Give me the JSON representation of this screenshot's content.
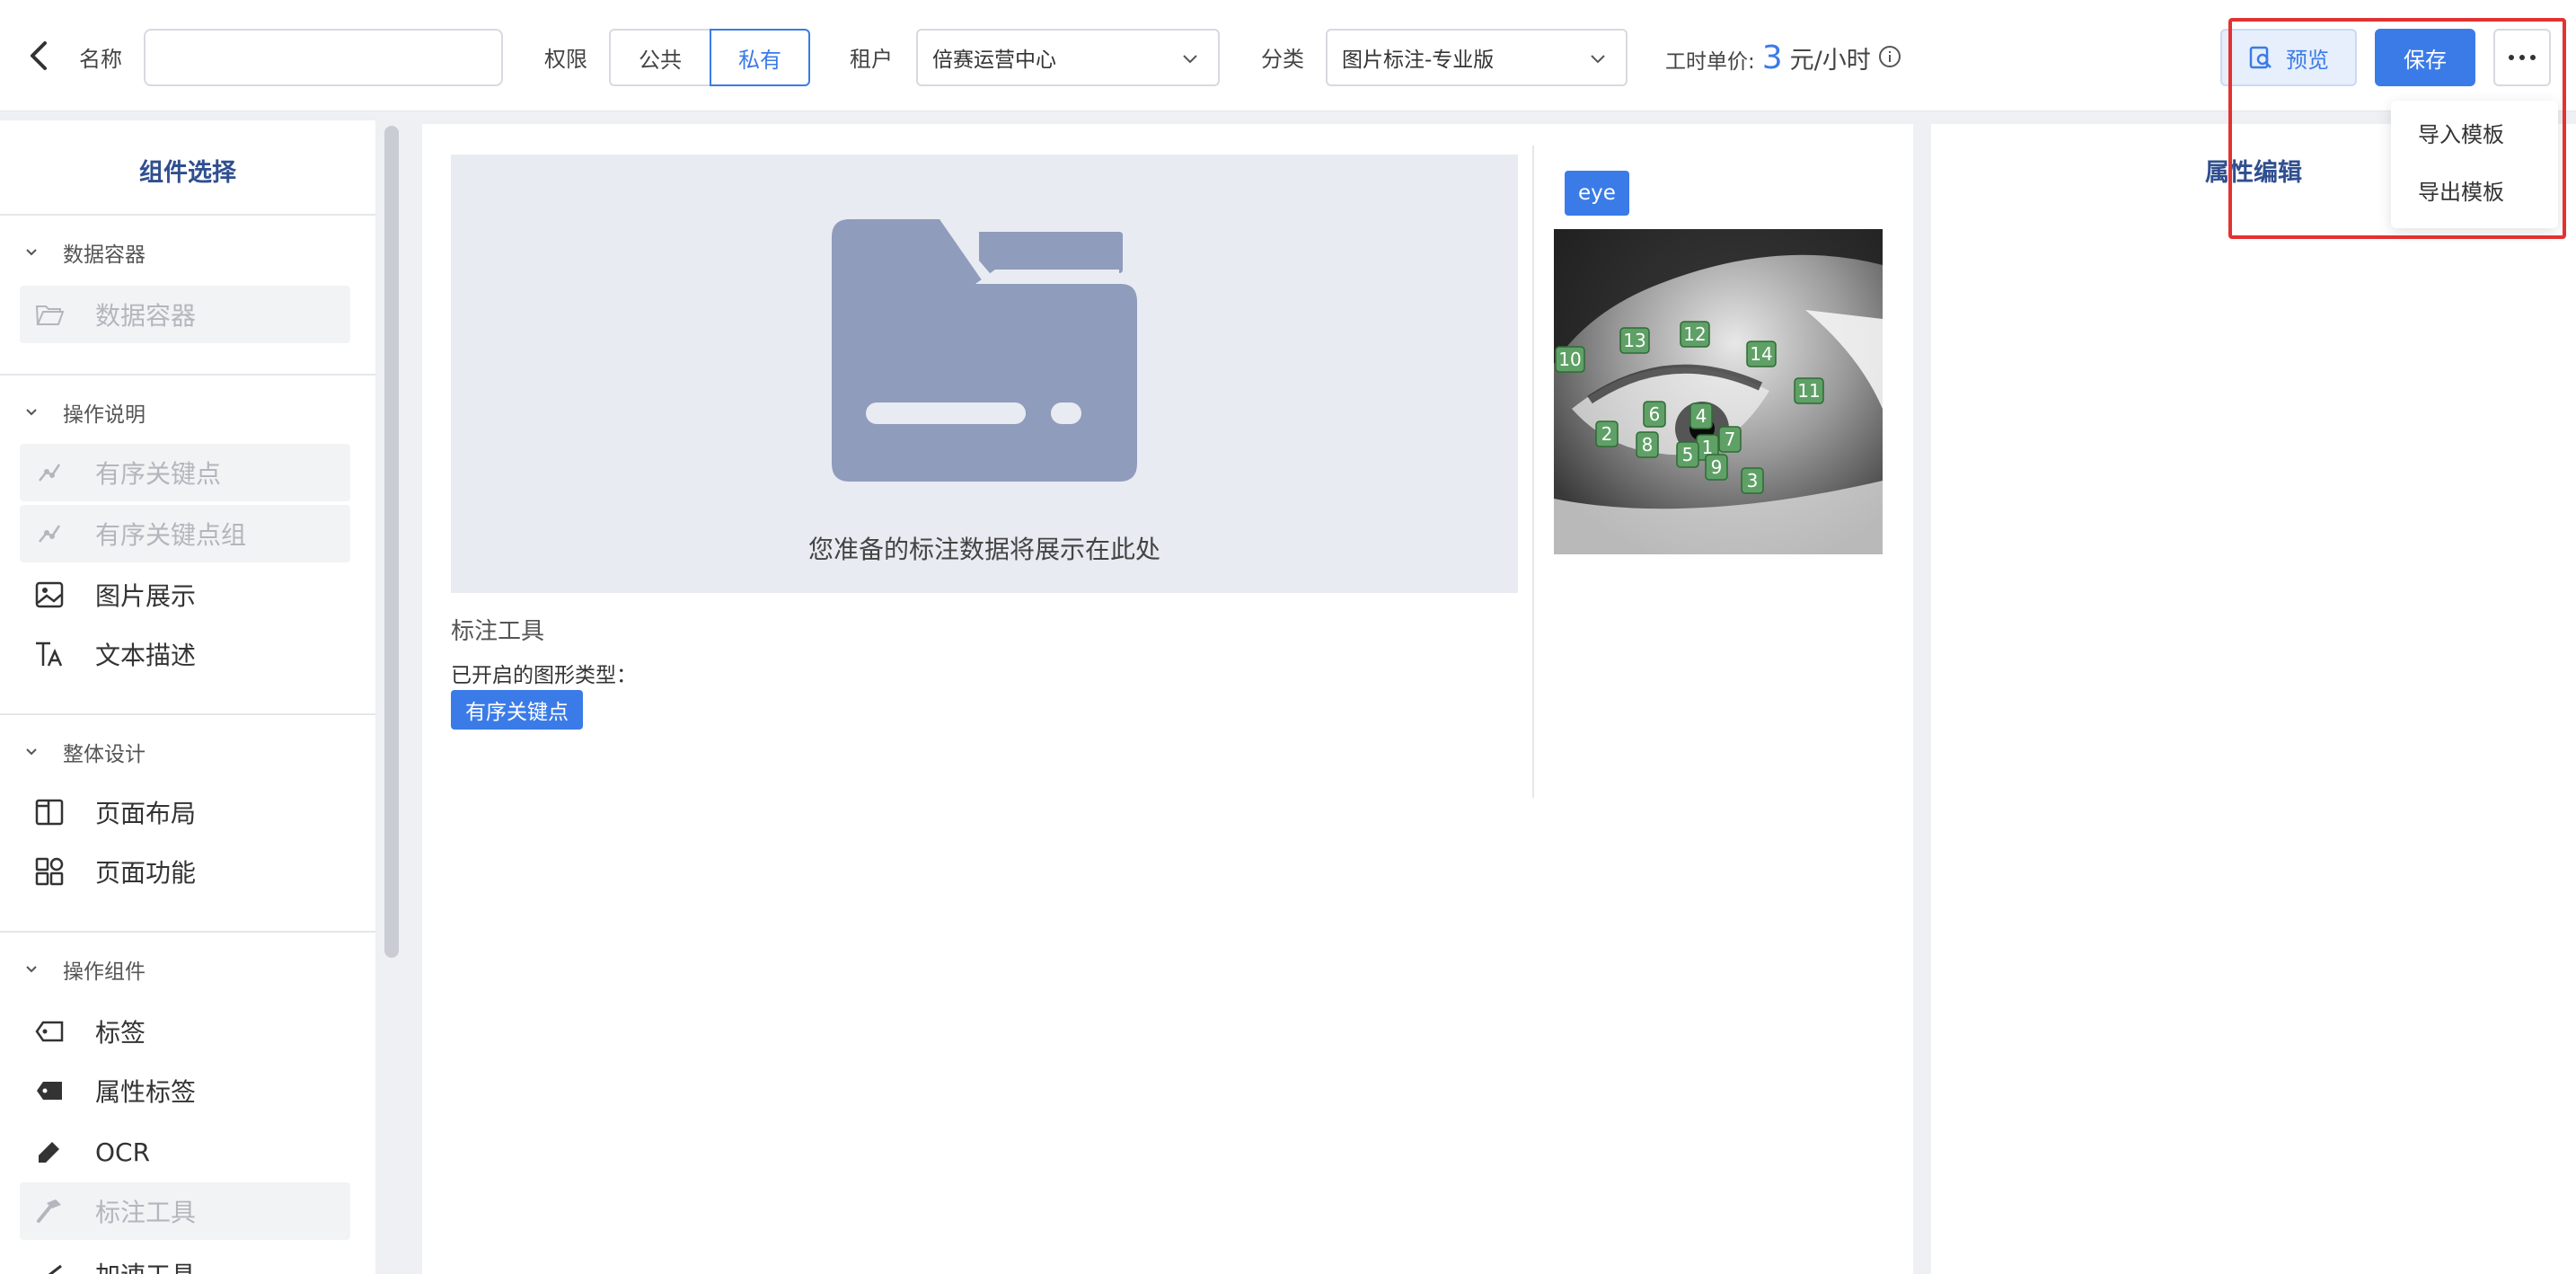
{
  "header": {
    "name_label": "名称",
    "name_value": "",
    "permission_label": "权限",
    "permission_options": [
      "公共",
      "私有"
    ],
    "tenant_label": "租户",
    "tenant_value": "倍赛运营中心",
    "category_label": "分类",
    "category_value": "图片标注-专业版",
    "price_label": "工时单价:",
    "price_value": "3",
    "price_unit": "元/小时",
    "preview_label": "预览",
    "save_label": "保存",
    "more_menu": [
      "导入模板",
      "导出模板"
    ]
  },
  "left_panel": {
    "title": "组件选择",
    "sections": [
      {
        "title": "数据容器",
        "items": [
          {
            "label": "数据容器",
            "icon": "folder-open-icon",
            "disabled": true
          }
        ]
      },
      {
        "title": "操作说明",
        "items": [
          {
            "label": "有序关键点",
            "icon": "keypoint-icon",
            "disabled": true
          },
          {
            "label": "有序关键点组",
            "icon": "keypoint-group-icon",
            "disabled": true
          },
          {
            "label": "图片展示",
            "icon": "image-icon",
            "disabled": false
          },
          {
            "label": "文本描述",
            "icon": "text-icon",
            "disabled": false
          }
        ]
      },
      {
        "title": "整体设计",
        "items": [
          {
            "label": "页面布局",
            "icon": "layout-icon",
            "disabled": false
          },
          {
            "label": "页面功能",
            "icon": "apps-icon",
            "disabled": false
          }
        ]
      },
      {
        "title": "操作组件",
        "items": [
          {
            "label": "标签",
            "icon": "tag-icon",
            "disabled": false
          },
          {
            "label": "属性标签",
            "icon": "attr-tag-icon",
            "disabled": false
          },
          {
            "label": "OCR",
            "icon": "pen-icon",
            "disabled": false
          },
          {
            "label": "标注工具",
            "icon": "hammer-icon",
            "disabled": true
          },
          {
            "label": "加速工具",
            "icon": "speed-icon",
            "disabled": false
          }
        ]
      }
    ]
  },
  "canvas": {
    "placeholder_text": "您准备的标注数据将展示在此处",
    "tool_title": "标注工具",
    "enabled_types_label": "已开启的图形类型：",
    "enabled_type_tag": "有序关键点",
    "image_tag": "eye",
    "keypoints": [
      "10",
      "13",
      "12",
      "14",
      "11",
      "6",
      "4",
      "2",
      "8",
      "1",
      "7",
      "5",
      "9",
      "3"
    ]
  },
  "right_panel": {
    "title": "属性编辑"
  },
  "colors": {
    "accent": "#3a7be8",
    "highlight": "#e23232",
    "panel_title": "#2f4f8f"
  }
}
